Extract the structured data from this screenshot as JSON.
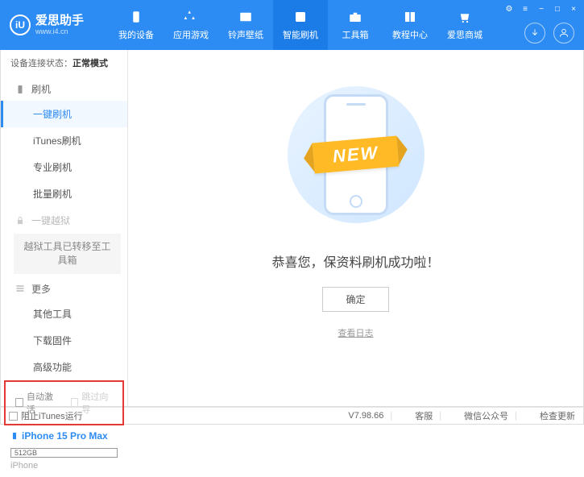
{
  "header": {
    "app_name": "爱思助手",
    "app_url": "www.i4.cn",
    "logo_letter": "iU"
  },
  "nav": {
    "items": [
      {
        "label": "我的设备"
      },
      {
        "label": "应用游戏"
      },
      {
        "label": "铃声壁纸"
      },
      {
        "label": "智能刷机"
      },
      {
        "label": "工具箱"
      },
      {
        "label": "教程中心"
      },
      {
        "label": "爱思商城"
      }
    ]
  },
  "sidebar": {
    "status_label": "设备连接状态：",
    "status_value": "正常模式",
    "section_flash": "刷机",
    "items_flash": [
      "一键刷机",
      "iTunes刷机",
      "专业刷机",
      "批量刷机"
    ],
    "section_jailbreak": "一键越狱",
    "jailbreak_note": "越狱工具已转移至工具箱",
    "section_more": "更多",
    "items_more": [
      "其他工具",
      "下载固件",
      "高级功能"
    ],
    "checkbox1": "自动激活",
    "checkbox2": "跳过向导",
    "device_name": "iPhone 15 Pro Max",
    "device_storage": "512GB",
    "device_type": "iPhone"
  },
  "main": {
    "ribbon_text": "NEW",
    "success_message": "恭喜您，保资料刷机成功啦！",
    "ok_button": "确定",
    "view_log": "查看日志"
  },
  "footer": {
    "block_itunes": "阻止iTunes运行",
    "version": "V7.98.66",
    "support": "客服",
    "wechat": "微信公众号",
    "check_update": "检查更新"
  }
}
